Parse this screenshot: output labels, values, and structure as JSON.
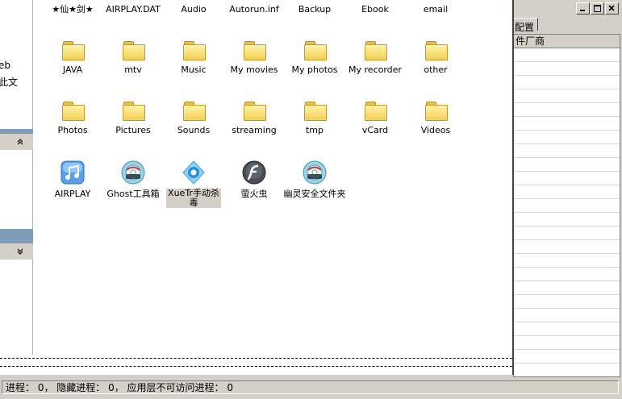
{
  "background_window": {
    "tab_label": "配置",
    "column_header": "件厂商"
  },
  "left_panel": {
    "text_line1": "eb",
    "text_line2": "此文",
    "collapse_glyph": "⌃",
    "expand_glyph": "⌄"
  },
  "items": [
    {
      "label": "★仙★剑★",
      "icon": "folder-icon"
    },
    {
      "label": "AIRPLAY.DAT",
      "icon": "file-icon"
    },
    {
      "label": "Audio",
      "icon": "folder-icon"
    },
    {
      "label": "Autorun.inf",
      "icon": "file-icon"
    },
    {
      "label": "Backup",
      "icon": "folder-icon"
    },
    {
      "label": "Ebook",
      "icon": "folder-icon"
    },
    {
      "label": "email",
      "icon": "folder-icon"
    },
    {
      "label": "JAVA",
      "icon": "folder-icon"
    },
    {
      "label": "mtv",
      "icon": "folder-icon"
    },
    {
      "label": "Music",
      "icon": "folder-icon"
    },
    {
      "label": "My movies",
      "icon": "folder-icon"
    },
    {
      "label": "My photos",
      "icon": "folder-icon"
    },
    {
      "label": "My recorder",
      "icon": "folder-icon"
    },
    {
      "label": "other",
      "icon": "folder-icon"
    },
    {
      "label": "Photos",
      "icon": "folder-icon"
    },
    {
      "label": "Pictures",
      "icon": "folder-icon"
    },
    {
      "label": "Sounds",
      "icon": "folder-icon"
    },
    {
      "label": "streaming",
      "icon": "folder-icon"
    },
    {
      "label": "tmp",
      "icon": "folder-icon"
    },
    {
      "label": "vCard",
      "icon": "folder-icon"
    },
    {
      "label": "Videos",
      "icon": "folder-icon"
    },
    {
      "label": "AIRPLAY",
      "icon": "music-app-icon"
    },
    {
      "label": "Ghost工具箱",
      "icon": "ghost-disc-icon"
    },
    {
      "label": "XueTr手动杀毒",
      "icon": "xuetr-icon",
      "selected": true
    },
    {
      "label": "萤火虫",
      "icon": "flash-icon"
    },
    {
      "label": "幽灵安全文件夹",
      "icon": "ghost-disc-icon"
    }
  ],
  "status_bar": {
    "text": "进程： 0， 隐藏进程： 0， 应用层不可访问进程： 0"
  },
  "colors": {
    "window_face": "#d4d0c8",
    "folder_yellow": "#f3cf55",
    "selection": "#d4d0c8"
  }
}
